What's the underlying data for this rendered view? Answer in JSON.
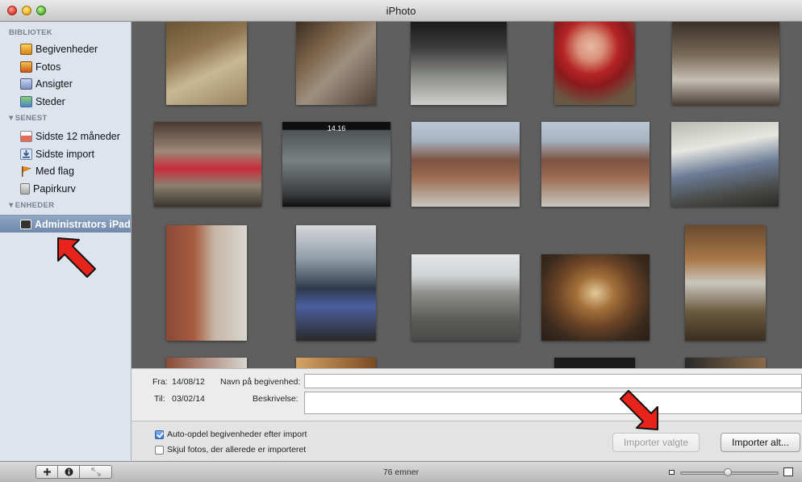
{
  "window": {
    "title": "iPhoto"
  },
  "sidebar": {
    "sections": [
      {
        "label": "BIBLIOTEK",
        "items": [
          {
            "label": "Begivenheder",
            "icon": "events-icon"
          },
          {
            "label": "Fotos",
            "icon": "photos-icon"
          },
          {
            "label": "Ansigter",
            "icon": "faces-icon"
          },
          {
            "label": "Steder",
            "icon": "places-icon"
          }
        ]
      },
      {
        "label": "SENEST",
        "items": [
          {
            "label": "Sidste 12 måneder",
            "icon": "calendar-icon"
          },
          {
            "label": "Sidste import",
            "icon": "import-icon"
          },
          {
            "label": "Med flag",
            "icon": "flag-icon"
          },
          {
            "label": "Papirkurv",
            "icon": "trash-icon"
          }
        ]
      },
      {
        "label": "ENHEDER",
        "items": [
          {
            "label": "Administrators iPad",
            "icon": "ipad-icon",
            "selected": true
          }
        ]
      }
    ]
  },
  "info_panel": {
    "from_label": "Fra:",
    "from_date": "14/08/12",
    "to_label": "Til:",
    "to_date": "03/02/14",
    "event_name_label": "Navn på begivenhed:",
    "event_name_value": "",
    "description_label": "Beskrivelse:",
    "description_value": ""
  },
  "import_bar": {
    "auto_split_label": "Auto-opdel begivenheder efter import",
    "auto_split_checked": true,
    "hide_imported_label": "Skjul fotos, der allerede er importeret",
    "hide_imported_checked": false,
    "import_selected_label": "Importer valgte",
    "import_selected_enabled": false,
    "import_all_label": "Importer alt..."
  },
  "status_bar": {
    "item_count": "76 emner",
    "zoom_level": 0.48
  },
  "colors": {
    "grid_background": "#5f5f5f",
    "sidebar_background": "#dde4ee",
    "selection": "#7a91b2",
    "annotation_arrow": "#e8231b"
  }
}
